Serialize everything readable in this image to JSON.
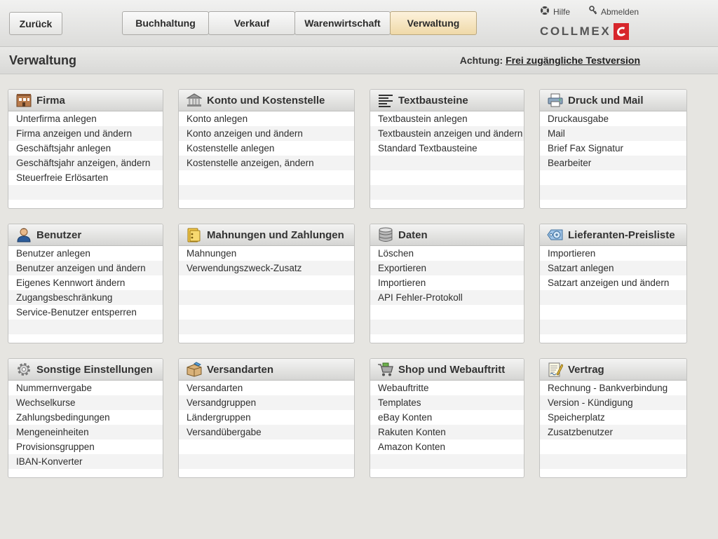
{
  "header": {
    "back_label": "Zurück",
    "tabs": [
      {
        "label": "Buchhaltung"
      },
      {
        "label": "Verkauf"
      },
      {
        "label": "Warenwirtschaft"
      },
      {
        "label": "Verwaltung"
      }
    ],
    "help_label": "Hilfe",
    "logout_label": "Abmelden",
    "logo_text": "COLLMEX"
  },
  "subheader": {
    "title": "Verwaltung",
    "notice_prefix": "Achtung:",
    "notice_link": "Frei zugängliche Testversion"
  },
  "panels": [
    {
      "title": "Firma",
      "icon": "building-icon",
      "items": [
        "Unterfirma anlegen",
        "Firma anzeigen und ändern",
        "Geschäftsjahr anlegen",
        "Geschäftsjahr anzeigen, ändern",
        "Steuerfreie Erlösarten"
      ]
    },
    {
      "title": "Konto und Kostenstelle",
      "icon": "bank-icon",
      "items": [
        "Konto anlegen",
        "Konto anzeigen und ändern",
        "Kostenstelle anlegen",
        "Kostenstelle anzeigen, ändern"
      ]
    },
    {
      "title": "Textbausteine",
      "icon": "text-lines-icon",
      "items": [
        "Textbaustein anlegen",
        "Textbaustein anzeigen und ändern",
        "Standard Textbausteine"
      ]
    },
    {
      "title": "Druck und Mail",
      "icon": "printer-icon",
      "items": [
        "Druckausgabe",
        "Mail",
        "Brief Fax Signatur",
        "Bearbeiter"
      ]
    },
    {
      "title": "Benutzer",
      "icon": "user-icon",
      "items": [
        "Benutzer anlegen",
        "Benutzer anzeigen und ändern",
        "Eigenes Kennwort ändern",
        "Zugangsbeschränkung",
        "Service-Benutzer entsperren"
      ]
    },
    {
      "title": "Mahnungen und Zahlungen",
      "icon": "folder-icon",
      "items": [
        "Mahnungen",
        "Verwendungszweck-Zusatz"
      ]
    },
    {
      "title": "Daten",
      "icon": "database-icon",
      "items": [
        "Löschen",
        "Exportieren",
        "Importieren",
        "API Fehler-Protokoll"
      ]
    },
    {
      "title": "Lieferanten-Preisliste",
      "icon": "price-tag-icon",
      "items": [
        "Importieren",
        "Satzart anlegen",
        "Satzart anzeigen und ändern"
      ]
    },
    {
      "title": "Sonstige Einstellungen",
      "icon": "gear-icon",
      "items": [
        "Nummernvergabe",
        "Wechselkurse",
        "Zahlungsbedingungen",
        "Mengeneinheiten",
        "Provisionsgruppen",
        "IBAN-Konverter"
      ]
    },
    {
      "title": "Versandarten",
      "icon": "package-icon",
      "items": [
        "Versandarten",
        "Versandgruppen",
        "Ländergruppen",
        "Versandübergabe"
      ]
    },
    {
      "title": "Shop und Webauftritt",
      "icon": "shopping-cart-icon",
      "items": [
        "Webauftritte",
        "Templates",
        "eBay Konten",
        "Rakuten Konten",
        "Amazon Konten"
      ]
    },
    {
      "title": "Vertrag",
      "icon": "contract-icon",
      "items": [
        "Rechnung - Bankverbindung",
        "Version - Kündigung",
        "Speicherplatz",
        "Zusatzbenutzer"
      ]
    }
  ]
}
